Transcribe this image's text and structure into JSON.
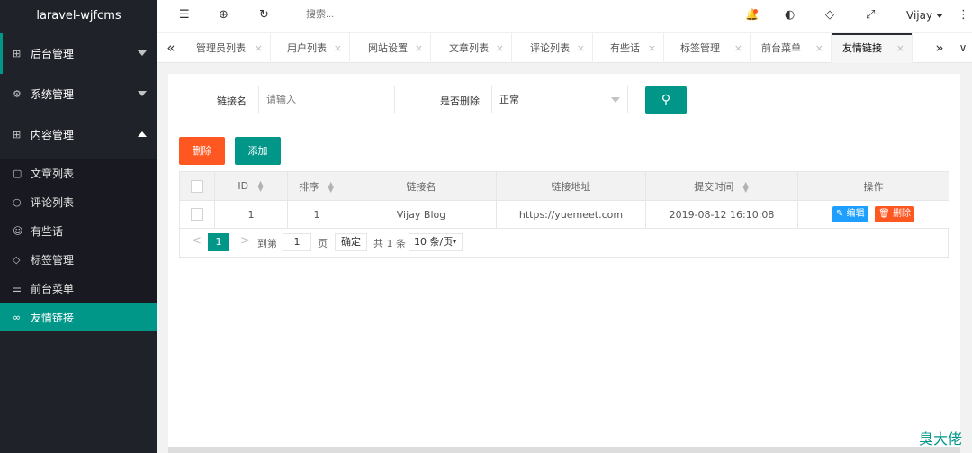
{
  "app": {
    "logo": "laravel-wjfcms"
  },
  "sidebar": {
    "groups": [
      {
        "label": "后台管理",
        "icon": "⊞"
      },
      {
        "label": "系统管理",
        "icon": "⚙"
      },
      {
        "label": "内容管理",
        "icon": "⊞"
      }
    ],
    "items": [
      {
        "label": "文章列表",
        "icon": "▢"
      },
      {
        "label": "评论列表",
        "icon": "○"
      },
      {
        "label": "有些话",
        "icon": "☺"
      },
      {
        "label": "标签管理",
        "icon": "◇"
      },
      {
        "label": "前台菜单",
        "icon": "☰"
      },
      {
        "label": "友情链接",
        "icon": "∞"
      }
    ]
  },
  "header": {
    "icons": {
      "menu": "☰",
      "globe": "⊕",
      "refresh": "↻",
      "bell": "🔔",
      "theme": "◐",
      "tag": "◇",
      "fullscreen": "⤢",
      "more": "⋮"
    },
    "search_placeholder": "搜索...",
    "user": "Vijay"
  },
  "tabs": {
    "prev": "«",
    "next": "»",
    "dropdown": "∨",
    "close": "×",
    "items": [
      {
        "label": "管理员列表"
      },
      {
        "label": "用户列表"
      },
      {
        "label": "网站设置"
      },
      {
        "label": "文章列表"
      },
      {
        "label": "评论列表"
      },
      {
        "label": "有些话"
      },
      {
        "label": "标签管理"
      },
      {
        "label": "前台菜单"
      },
      {
        "label": "友情链接"
      }
    ]
  },
  "filter": {
    "name_label": "链接名",
    "name_placeholder": "请输入",
    "deleted_label": "是否删除",
    "deleted_value": "正常",
    "search_icon": "⚲"
  },
  "actions": {
    "delete": "删除",
    "add": "添加"
  },
  "table": {
    "headers": [
      "ID",
      "排序",
      "链接名",
      "链接地址",
      "提交时间",
      "操作"
    ],
    "sort_up": "▲",
    "sort_down": "▼",
    "rows": [
      {
        "id": "1",
        "sort": "1",
        "name": "Vijay Blog",
        "url": "https://yuemeet.com",
        "time": "2019-08-12 16:10:08",
        "edit": "✎ 编辑",
        "delete": "🗑 删除"
      }
    ]
  },
  "pager": {
    "prev": "<",
    "current": "1",
    "next": ">",
    "goto": "到第",
    "input": "1",
    "page": "页",
    "confirm": "确定",
    "total": "共 1 条",
    "limit": "10 条/页",
    "limit_caret": "▾"
  },
  "watermark": "臭大佬",
  "colors": {
    "accent": "#009688",
    "danger": "#ff5722",
    "info": "#1e9fff",
    "sidebar": "#20222a"
  }
}
